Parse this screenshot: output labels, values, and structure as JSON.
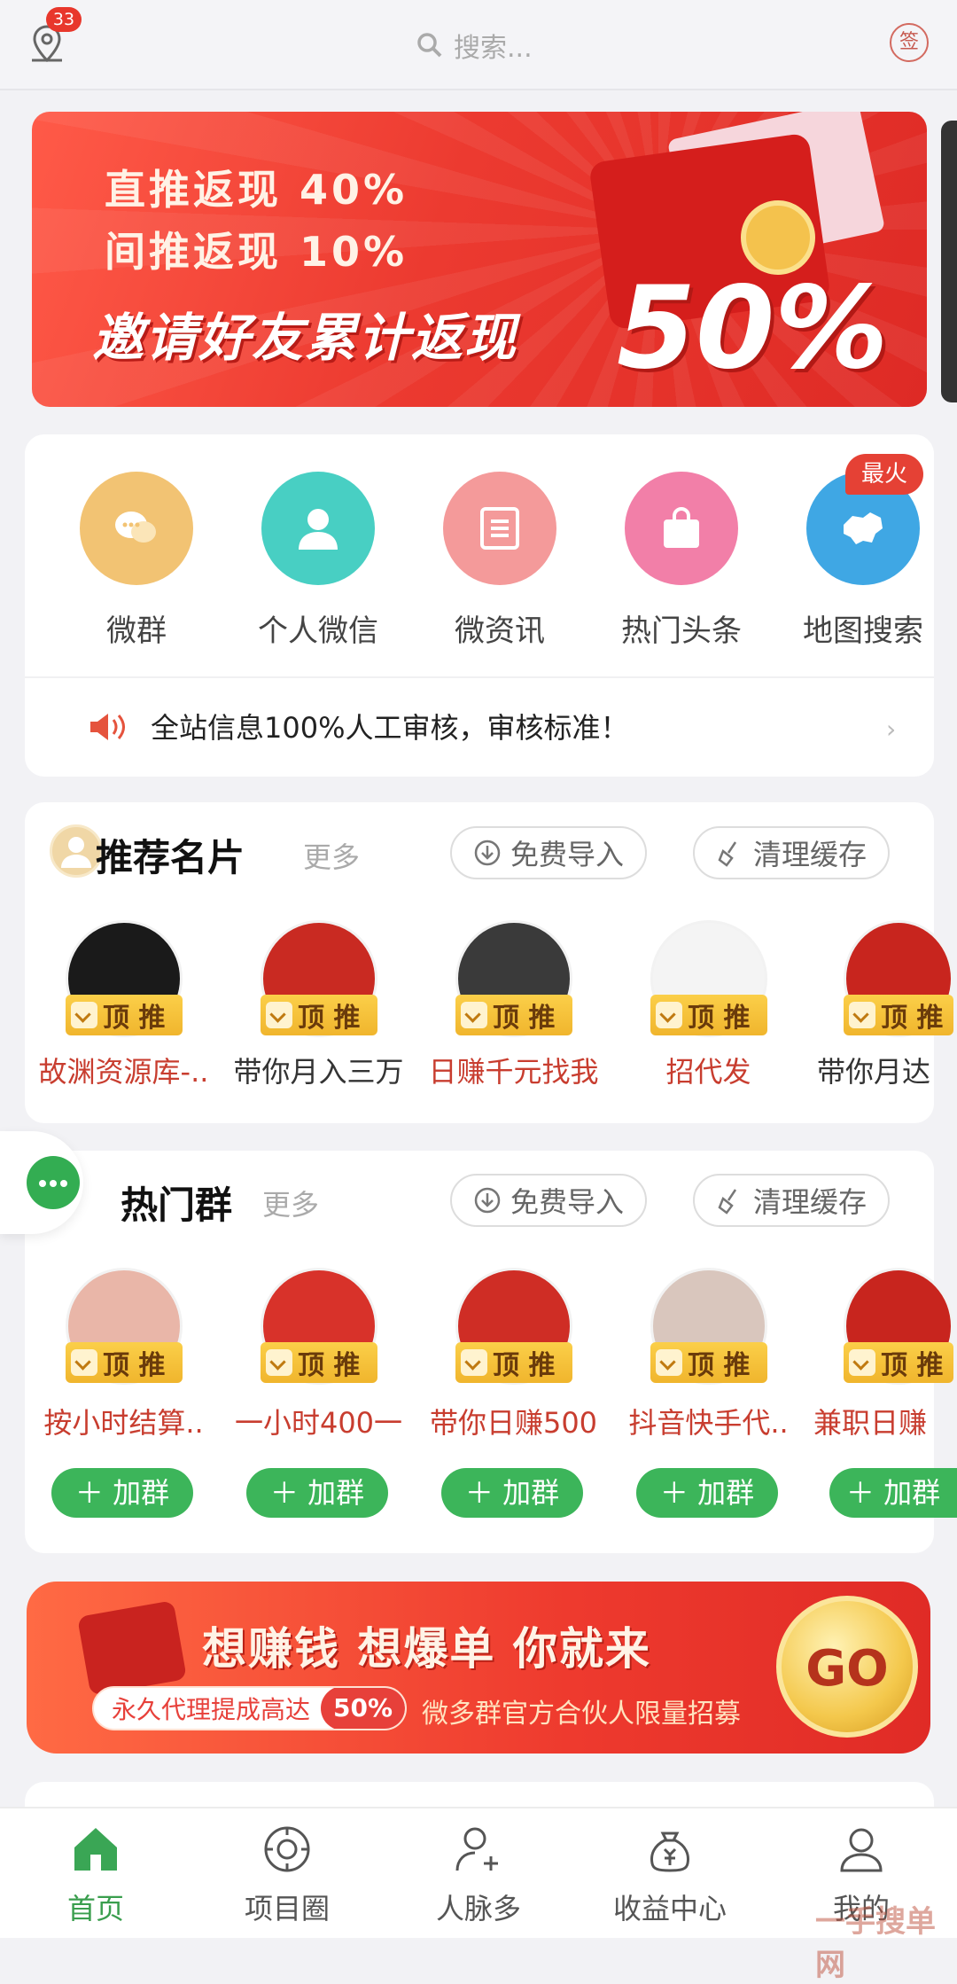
{
  "topbar": {
    "badge_count": "33",
    "search_placeholder": "搜索...",
    "sign_label": "签"
  },
  "banner": {
    "line1": "直推返现 40%",
    "line2": "间推返现 10%",
    "line3": "邀请好友累计返现",
    "big": "50%"
  },
  "menu": {
    "hot_badge": "最火",
    "items": [
      {
        "label": "微群",
        "color": "#f2c373",
        "icon": "chat-icon"
      },
      {
        "label": "个人微信",
        "color": "#48cfc3",
        "icon": "person-icon"
      },
      {
        "label": "微资讯",
        "color": "#f49a9a",
        "icon": "news-icon"
      },
      {
        "label": "热门头条",
        "color": "#f27fa8",
        "icon": "bag-icon"
      },
      {
        "label": "地图搜索",
        "color": "#3fa7e4",
        "icon": "map-icon"
      }
    ]
  },
  "notice": {
    "text": "全站信息100%人工审核，审核标准！"
  },
  "cards": {
    "title": "推荐名片",
    "more": "更多",
    "import": "免费导入",
    "clear": "清理缓存",
    "tag": "顶 推",
    "items": [
      {
        "name": "故渊资源库-..",
        "style": "red",
        "avatar_bg": "#1a1a1a"
      },
      {
        "name": "带你月入三万",
        "style": "blk",
        "avatar_bg": "#c92a22"
      },
      {
        "name": "日赚千元找我",
        "style": "red",
        "avatar_bg": "#3a3a3a"
      },
      {
        "name": "招代发",
        "style": "red",
        "avatar_bg": "#f4f4f4"
      },
      {
        "name": "带你月达",
        "style": "blk",
        "avatar_bg": "#c8251e"
      }
    ]
  },
  "groups": {
    "title": "热门群",
    "more": "更多",
    "import": "免费导入",
    "clear": "清理缓存",
    "tag": "顶 推",
    "join": "加群",
    "items": [
      {
        "name": "按小时结算..",
        "avatar_bg": "#e9b6a8"
      },
      {
        "name": "一小时400一",
        "avatar_bg": "#d8322a"
      },
      {
        "name": "带你日赚500",
        "avatar_bg": "#cf2d25"
      },
      {
        "name": "抖音快手代..",
        "avatar_bg": "#d9c6bd"
      },
      {
        "name": "兼职日赚",
        "avatar_bg": "#c8251e"
      }
    ]
  },
  "promo": {
    "title": "想赚钱 想爆单 你就来",
    "sub_text": "永久代理提成高达",
    "sub_percent": "50%",
    "sub2": "微多群官方合伙人限量招募",
    "go": "GO"
  },
  "tabbar": [
    {
      "label": "首页",
      "active": true,
      "icon": "home-icon"
    },
    {
      "label": "项目圈",
      "active": false,
      "icon": "project-circle-icon"
    },
    {
      "label": "人脉多",
      "active": false,
      "icon": "add-contact-icon"
    },
    {
      "label": "收益中心",
      "active": false,
      "icon": "money-bag-icon"
    },
    {
      "label": "我的",
      "active": false,
      "icon": "profile-icon"
    }
  ],
  "watermark": "一手搜单网"
}
